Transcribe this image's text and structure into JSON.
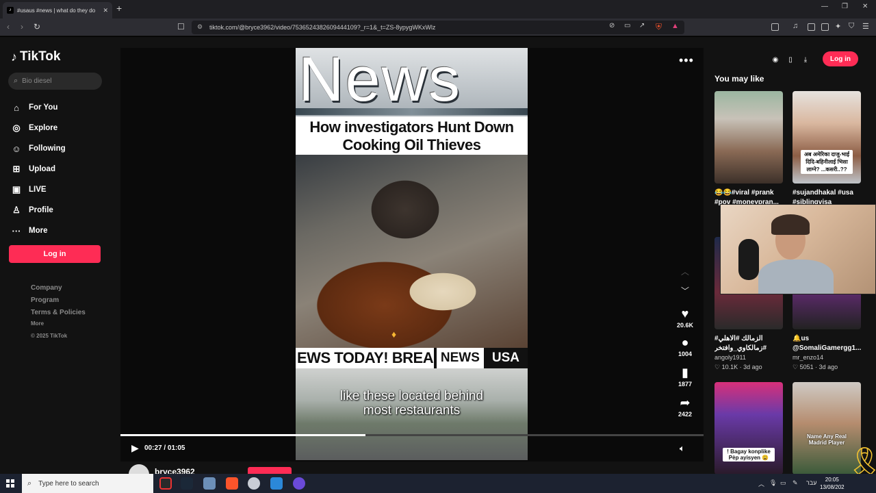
{
  "browser": {
    "tab_title": "#usaus #news | what do they do",
    "tab_icon": "tiktok-icon",
    "url": "tiktok.com/@bryce3962/video/7536524382609444109?_r=1&_t=ZS-8ypygWKxWlz"
  },
  "sidebar": {
    "logo": "TikTok",
    "search_placeholder": "Bio diesel",
    "nav": [
      {
        "label": "For You",
        "icon": "home-icon"
      },
      {
        "label": "Explore",
        "icon": "compass-icon"
      },
      {
        "label": "Following",
        "icon": "user-icon"
      },
      {
        "label": "Upload",
        "icon": "plus-square-icon"
      },
      {
        "label": "LIVE",
        "icon": "live-tv-icon"
      },
      {
        "label": "Profile",
        "icon": "profile-icon"
      },
      {
        "label": "More",
        "icon": "more-dots-icon"
      }
    ],
    "login": "Log in",
    "footer": {
      "company": "Company",
      "program": "Program",
      "terms": "Terms & Policies",
      "more": "More",
      "copyright": "© 2025 TikTok"
    }
  },
  "video": {
    "overlay_big": "News",
    "headline_line1": "How investigators Hunt Down",
    "headline_line2": "Cooking Oil Thieves",
    "ticker_left": "EWS TODAY! BREAI",
    "ticker_news": "NEWS",
    "ticker_usa": "USA",
    "caption_line1": "like these located behind",
    "caption_line2": "most restaurants",
    "progress_fraction": 0.42,
    "time": "00:27 / 01:05"
  },
  "actions": {
    "likes": "20.6K",
    "comments": "1004",
    "saves": "1877",
    "shares": "2422"
  },
  "author": {
    "name": "bryce3962"
  },
  "right": {
    "login": "Log in",
    "section_title": "You may like",
    "cards": [
      {
        "title": "😂😂#viral #prank #pov #moneypran...",
        "author": "",
        "likes": "",
        "age": ""
      },
      {
        "title": "#sujandhakal #usa #siblingvisa",
        "author": "",
        "likes": "",
        "age": "",
        "thumb_text": "अब अमेरिका दाजु-भाई दिदि-बहिनीलाई भिसा लाग्ने? ...कसरी..??"
      },
      {
        "title": "#الزمالك #الاهلي #زمالكاوي_وافتخر",
        "author": "angoly1911",
        "likes": "10.1K",
        "age": "3d ago"
      },
      {
        "title": "🔔us @SomaliGamergg1...",
        "author": "mr_enzo14",
        "likes": "5051",
        "age": "3d ago"
      },
      {
        "title": "",
        "author": "",
        "likes": "",
        "age": "",
        "thumb_text": "! Bagay konplike Pèp ayisyen 😩"
      },
      {
        "title": "",
        "author": "",
        "likes": "",
        "age": "",
        "thumb_text": "Name Any Real Madrid Player"
      }
    ]
  },
  "taskbar": {
    "search_placeholder": "Type here to search",
    "time": "20:05",
    "date": "13/08/202",
    "lang": "עבר"
  },
  "colors": {
    "accent": "#fe2c55",
    "background": "#121212"
  }
}
